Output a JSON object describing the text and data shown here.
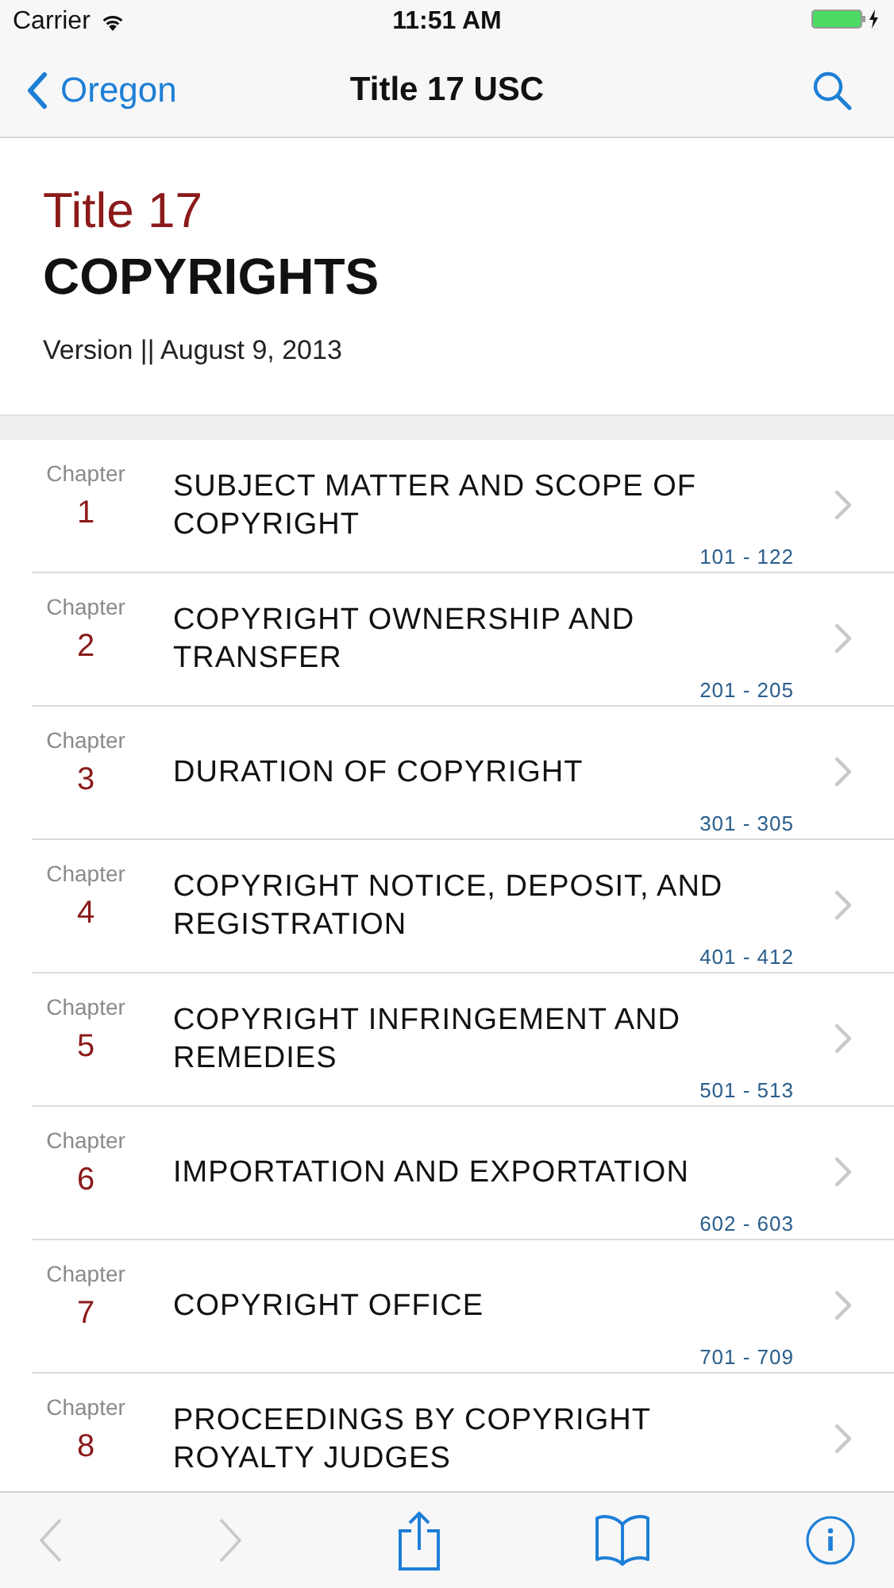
{
  "status_bar": {
    "carrier": "Carrier",
    "time": "11:51 AM"
  },
  "nav": {
    "back_label": "Oregon",
    "title": "Title 17 USC"
  },
  "header": {
    "title_number": "Title 17",
    "title_name": "COPYRIGHTS",
    "version": "Version || August 9, 2013"
  },
  "chapters": [
    {
      "label": "Chapter",
      "number": "1",
      "title": "SUBJECT MATTER AND SCOPE OF COPYRIGHT",
      "range": "101 - 122"
    },
    {
      "label": "Chapter",
      "number": "2",
      "title": "COPYRIGHT OWNERSHIP AND TRANSFER",
      "range": "201 - 205"
    },
    {
      "label": "Chapter",
      "number": "3",
      "title": "DURATION OF COPYRIGHT",
      "range": "301 - 305"
    },
    {
      "label": "Chapter",
      "number": "4",
      "title": "COPYRIGHT NOTICE, DEPOSIT, AND REGISTRATION",
      "range": "401 - 412"
    },
    {
      "label": "Chapter",
      "number": "5",
      "title": "COPYRIGHT INFRINGEMENT AND REMEDIES",
      "range": "501 - 513"
    },
    {
      "label": "Chapter",
      "number": "6",
      "title": "IMPORTATION AND EXPORTATION",
      "range": "602 - 603"
    },
    {
      "label": "Chapter",
      "number": "7",
      "title": "COPYRIGHT OFFICE",
      "range": "701 - 709"
    },
    {
      "label": "Chapter",
      "number": "8",
      "title": "PROCEEDINGS BY COPYRIGHT ROYALTY JUDGES"
    }
  ],
  "toolbar": [
    {
      "kind": "back",
      "disabled": true
    },
    {
      "kind": "forward",
      "disabled": true
    },
    {
      "kind": "share",
      "disabled": false
    },
    {
      "kind": "book",
      "disabled": false
    },
    {
      "kind": "info",
      "disabled": false
    }
  ]
}
